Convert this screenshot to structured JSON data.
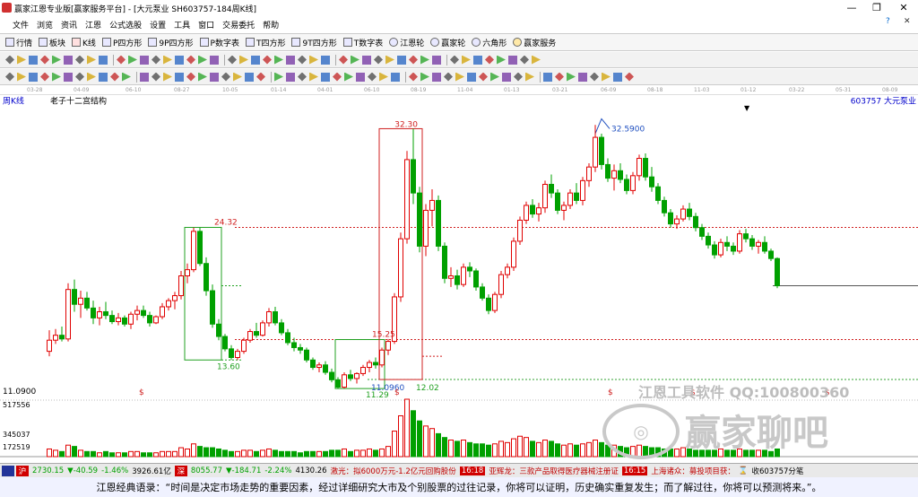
{
  "window": {
    "title": "赢家江恩专业版[赢家服务平台] - [大元泵业  SH603757-184周K线]",
    "minimize": "—",
    "maximize": "❐",
    "close": "✕"
  },
  "menu": [
    "文件",
    "浏览",
    "资讯",
    "江恩",
    "公式选股",
    "设置",
    "工具",
    "窗口",
    "交易委托",
    "帮助"
  ],
  "menu_right": {
    "help": "?",
    "close": "✕"
  },
  "toolbar": [
    "行情",
    "板块",
    "K线",
    "P四方形",
    "9P四方形",
    "P数字表",
    "T四方形",
    "9T四方形",
    "T数字表",
    "江恩轮",
    "赢家轮",
    "六角形",
    "赢家服务"
  ],
  "period_label": "周K线",
  "date_ticks": [
    "03-28",
    "04-09",
    "06-10",
    "08-27",
    "10-05",
    "01-14",
    "04-01",
    "06-10",
    "08-19",
    "11-04",
    "01-13",
    "03-21",
    "06-09",
    "08-18",
    "11-03",
    "01-12",
    "03-22",
    "05-31",
    "08-09"
  ],
  "chart": {
    "indicator_name": "老子十二宫结构",
    "stock_label": "603757  大元泵业",
    "price_labels": {
      "top": "32.30",
      "peak": "32.5900",
      "l1": "24.32",
      "l2": "15.25",
      "l3": "13.60",
      "l4": "12.02",
      "l5": "11.29",
      "l6": "11.0960",
      "left_low": "11.0900"
    },
    "volume_labels": [
      "517556",
      "345037",
      "172519"
    ],
    "dollar_marks": [
      "$",
      "$",
      "$",
      "$",
      "$"
    ]
  },
  "chart_data": {
    "type": "candlestick",
    "ohlc": [
      [
        14.3,
        16.0,
        13.9,
        15.2
      ],
      [
        15.2,
        16.1,
        14.9,
        15.6
      ],
      [
        15.6,
        16.3,
        15.1,
        15.3
      ],
      [
        15.3,
        19.8,
        15.1,
        19.3
      ],
      [
        19.3,
        20.1,
        17.5,
        18.1
      ],
      [
        18.1,
        19.2,
        17.0,
        18.6
      ],
      [
        18.6,
        19.1,
        17.6,
        17.8
      ],
      [
        17.8,
        18.4,
        16.5,
        17.0
      ],
      [
        17.0,
        17.9,
        16.4,
        17.5
      ],
      [
        17.5,
        18.3,
        16.9,
        17.2
      ],
      [
        17.2,
        17.6,
        16.5,
        16.7
      ],
      [
        16.7,
        17.4,
        16.4,
        17.0
      ],
      [
        17.0,
        17.2,
        16.3,
        16.5
      ],
      [
        16.5,
        17.5,
        16.1,
        17.3
      ],
      [
        17.3,
        18.0,
        16.8,
        17.6
      ],
      [
        17.6,
        18.0,
        17.0,
        17.2
      ],
      [
        17.2,
        17.5,
        16.3,
        16.6
      ],
      [
        16.6,
        17.2,
        16.5,
        17.1
      ],
      [
        17.1,
        18.2,
        16.9,
        17.9
      ],
      [
        17.9,
        18.6,
        17.6,
        18.4
      ],
      [
        18.4,
        19.1,
        17.7,
        18.8
      ],
      [
        18.8,
        20.8,
        18.5,
        20.4
      ],
      [
        20.4,
        21.4,
        19.8,
        20.9
      ],
      [
        20.9,
        24.3,
        20.7,
        24.0
      ],
      [
        24.0,
        24.3,
        21.2,
        21.4
      ],
      [
        21.4,
        21.9,
        18.8,
        19.2
      ],
      [
        19.2,
        19.7,
        16.2,
        16.5
      ],
      [
        16.5,
        16.9,
        15.2,
        15.5
      ],
      [
        15.5,
        15.7,
        14.3,
        14.5
      ],
      [
        14.5,
        14.8,
        13.6,
        13.8
      ],
      [
        13.8,
        14.5,
        13.6,
        14.3
      ],
      [
        14.3,
        15.4,
        14.1,
        15.2
      ],
      [
        15.2,
        16.1,
        15.0,
        15.9
      ],
      [
        15.9,
        16.6,
        15.4,
        15.6
      ],
      [
        15.6,
        16.8,
        15.5,
        16.6
      ],
      [
        16.6,
        17.8,
        16.3,
        17.5
      ],
      [
        17.5,
        17.9,
        16.4,
        16.6
      ],
      [
        16.6,
        16.9,
        15.6,
        15.8
      ],
      [
        15.8,
        16.1,
        14.8,
        15.0
      ],
      [
        15.0,
        15.4,
        14.3,
        14.6
      ],
      [
        14.6,
        14.9,
        14.1,
        14.4
      ],
      [
        14.4,
        14.6,
        13.4,
        13.6
      ],
      [
        13.6,
        13.8,
        12.8,
        13.0
      ],
      [
        13.0,
        13.4,
        12.6,
        13.2
      ],
      [
        13.2,
        13.5,
        12.4,
        12.6
      ],
      [
        12.6,
        12.9,
        11.8,
        12.0
      ],
      [
        12.0,
        12.2,
        11.3,
        11.4
      ],
      [
        11.4,
        12.6,
        11.3,
        12.4
      ],
      [
        12.4,
        12.8,
        11.9,
        12.1
      ],
      [
        12.1,
        12.6,
        11.7,
        12.5
      ],
      [
        12.5,
        13.2,
        12.3,
        13.0
      ],
      [
        13.0,
        13.6,
        12.6,
        13.4
      ],
      [
        13.4,
        13.8,
        12.9,
        13.2
      ],
      [
        13.2,
        14.6,
        13.0,
        14.4
      ],
      [
        14.4,
        15.3,
        14.0,
        15.1
      ],
      [
        15.1,
        19.0,
        14.9,
        18.7
      ],
      [
        18.7,
        23.9,
        18.3,
        23.4
      ],
      [
        23.4,
        30.5,
        23.0,
        29.8
      ],
      [
        29.8,
        32.3,
        26.2,
        27.1
      ],
      [
        27.1,
        27.6,
        22.3,
        22.8
      ],
      [
        22.8,
        26.2,
        22.0,
        25.7
      ],
      [
        25.7,
        27.4,
        24.4,
        26.5
      ],
      [
        26.5,
        26.9,
        22.4,
        22.8
      ],
      [
        22.8,
        23.1,
        19.8,
        20.2
      ],
      [
        20.2,
        21.1,
        19.5,
        20.4
      ],
      [
        20.4,
        20.9,
        19.3,
        19.7
      ],
      [
        19.7,
        21.4,
        19.5,
        21.1
      ],
      [
        21.1,
        21.5,
        20.3,
        20.8
      ],
      [
        20.8,
        21.0,
        19.2,
        19.5
      ],
      [
        19.5,
        19.8,
        18.4,
        18.6
      ],
      [
        18.6,
        18.9,
        17.3,
        17.6
      ],
      [
        17.6,
        19.1,
        17.4,
        18.9
      ],
      [
        18.9,
        20.8,
        18.6,
        20.5
      ],
      [
        20.5,
        21.4,
        20.2,
        21.1
      ],
      [
        21.1,
        23.5,
        20.8,
        23.2
      ],
      [
        23.2,
        25.2,
        22.9,
        24.9
      ],
      [
        24.9,
        26.4,
        24.6,
        26.1
      ],
      [
        26.1,
        26.6,
        25.1,
        25.4
      ],
      [
        25.4,
        26.3,
        24.8,
        25.9
      ],
      [
        25.9,
        28.1,
        25.5,
        27.8
      ],
      [
        27.8,
        28.6,
        26.7,
        27.1
      ],
      [
        27.1,
        27.4,
        25.4,
        25.7
      ],
      [
        25.7,
        26.4,
        24.9,
        26.1
      ],
      [
        26.1,
        27.4,
        25.8,
        27.1
      ],
      [
        27.1,
        27.9,
        26.2,
        26.5
      ],
      [
        26.5,
        28.4,
        26.1,
        28.1
      ],
      [
        28.1,
        29.5,
        27.6,
        29.2
      ],
      [
        29.2,
        32.6,
        28.8,
        31.6
      ],
      [
        31.6,
        31.9,
        29.0,
        29.4
      ],
      [
        29.4,
        29.9,
        28.0,
        28.3
      ],
      [
        28.3,
        29.4,
        27.3,
        28.9
      ],
      [
        28.9,
        29.5,
        27.9,
        28.2
      ],
      [
        28.2,
        28.6,
        27.0,
        27.3
      ],
      [
        27.3,
        28.8,
        27.0,
        28.5
      ],
      [
        28.5,
        30.2,
        28.1,
        29.9
      ],
      [
        29.9,
        30.3,
        28.1,
        28.4
      ],
      [
        28.4,
        29.2,
        27.2,
        27.6
      ],
      [
        27.6,
        27.9,
        26.2,
        26.5
      ],
      [
        26.5,
        26.8,
        25.2,
        25.5
      ],
      [
        25.5,
        25.8,
        24.3,
        24.6
      ],
      [
        24.6,
        25.3,
        24.2,
        25.0
      ],
      [
        25.0,
        26.1,
        24.8,
        25.8
      ],
      [
        25.8,
        26.3,
        24.9,
        25.2
      ],
      [
        25.2,
        25.5,
        24.0,
        24.3
      ],
      [
        24.3,
        24.6,
        23.3,
        23.6
      ],
      [
        23.6,
        23.9,
        22.6,
        22.9
      ],
      [
        22.9,
        23.2,
        21.8,
        22.1
      ],
      [
        22.1,
        23.4,
        21.9,
        23.1
      ],
      [
        23.1,
        23.6,
        22.4,
        22.8
      ],
      [
        22.8,
        23.1,
        22.1,
        22.4
      ],
      [
        22.4,
        24.1,
        22.2,
        23.8
      ],
      [
        23.8,
        24.2,
        23.1,
        23.4
      ],
      [
        23.4,
        23.7,
        22.5,
        22.8
      ],
      [
        22.8,
        23.3,
        22.2,
        23.1
      ],
      [
        23.1,
        23.6,
        22.2,
        22.4
      ],
      [
        22.4,
        22.6,
        21.6,
        21.8
      ],
      [
        21.8,
        21.9,
        19.4,
        19.6
      ]
    ],
    "volume": [
      6,
      5,
      4,
      9,
      8,
      5,
      4,
      4,
      3,
      4,
      3,
      3,
      3,
      4,
      4,
      3,
      3,
      3,
      4,
      4,
      4,
      7,
      6,
      10,
      8,
      7,
      7,
      6,
      5,
      4,
      4,
      5,
      5,
      4,
      5,
      6,
      5,
      4,
      4,
      4,
      3,
      4,
      4,
      4,
      4,
      5,
      5,
      6,
      4,
      5,
      5,
      6,
      5,
      6,
      8,
      20,
      32,
      45,
      36,
      28,
      24,
      22,
      18,
      15,
      13,
      12,
      13,
      11,
      10,
      10,
      9,
      10,
      12,
      11,
      14,
      16,
      15,
      12,
      11,
      13,
      12,
      10,
      9,
      10,
      9,
      10,
      11,
      13,
      11,
      9,
      9,
      8,
      7,
      8,
      9,
      8,
      7,
      7,
      6,
      6,
      6,
      7,
      6,
      5,
      5,
      5,
      5,
      6,
      5,
      5,
      6,
      5,
      5,
      5,
      5,
      4,
      6
    ],
    "ylim": [
      10.5,
      34
    ],
    "hlines": [
      24.32,
      15.25,
      12.02,
      19.6
    ],
    "green_box": {
      "x0": 22,
      "x1": 27,
      "y0": 24.32,
      "y1": 13.6
    },
    "green_box2": {
      "x0": 46,
      "x1": 53,
      "y0": 15.25,
      "y1": 11.29
    },
    "red_box": {
      "x0": 53,
      "x1": 59,
      "y0": 32.3,
      "y1": 12.02
    }
  },
  "status": {
    "sh": "2730.15",
    "sh_chg": "▼-40.59",
    "sh_pct": "-1.46%",
    "sh_amt": "3926.61亿",
    "sz": "8055.77",
    "sz_chg": "▼-184.71",
    "sz_pct": "-2.24%",
    "sz_amt": "4130.26",
    "news1": "激光：拟6000万元-1.2亿元回购股份",
    "time1": "16:18",
    "news2": "亚辉龙：三款产品取得医疗器械注册证",
    "time2": "16:15",
    "news3": "上海诸众：募投项目获：",
    "tail": "收603757分笔"
  },
  "watermark": {
    "line1": "江恩工具软件 QQ:100800360",
    "line2": "赢家聊吧"
  },
  "quote": "江恩经典语录：“时间是决定市场走势的重要因素，经过详细研究大市及个别股票的过往记录，你将可以证明，历史确实重复发生；而了解过往，你将可以预测将来。”。",
  "colors": {
    "up": "#e00000",
    "down": "#00a000",
    "bg": "#ffffff"
  }
}
